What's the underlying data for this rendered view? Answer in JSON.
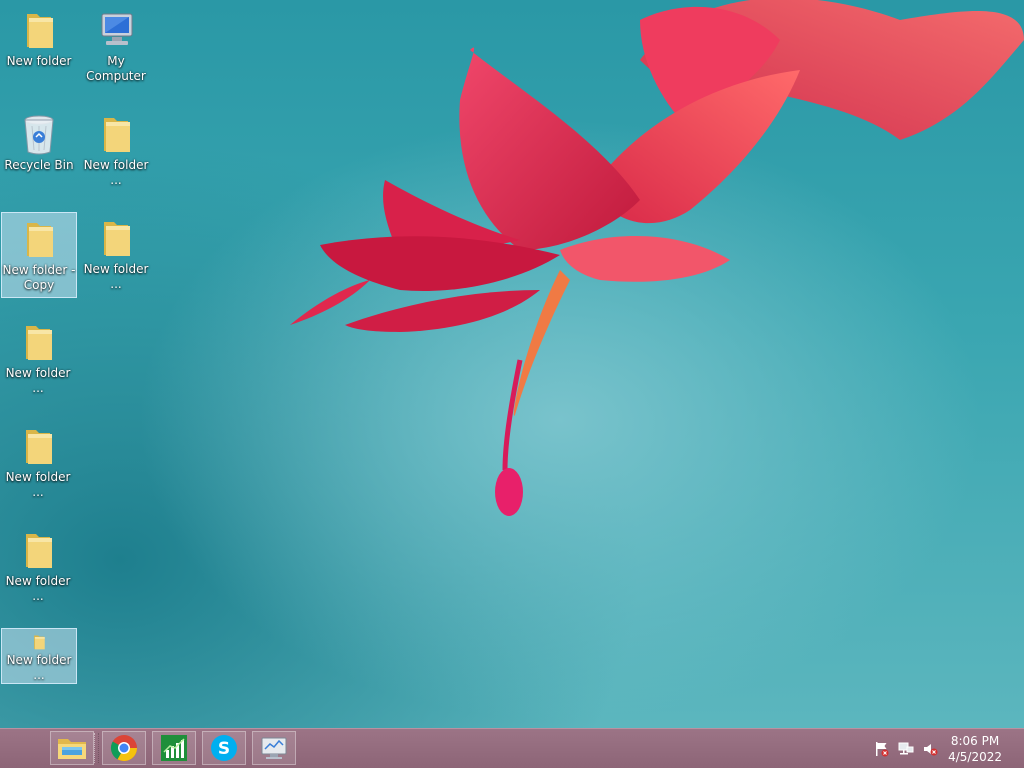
{
  "desktop": {
    "icons": [
      {
        "label": "New folder",
        "icon": "folder-icon",
        "selected": false
      },
      {
        "label": "My Computer",
        "icon": "computer-icon",
        "selected": false
      },
      {
        "label": "Recycle Bin",
        "icon": "recycle-bin-icon",
        "selected": false
      },
      {
        "label": "New folder ...",
        "icon": "folder-icon",
        "selected": false
      },
      {
        "label": "New folder - Copy",
        "icon": "folder-icon",
        "selected": true
      },
      {
        "label": "New folder ...",
        "icon": "folder-icon",
        "selected": false
      },
      {
        "label": "New folder ...",
        "icon": "folder-icon",
        "selected": false
      },
      {
        "label": "New folder ...",
        "icon": "folder-icon",
        "selected": false
      },
      {
        "label": "New folder ...",
        "icon": "folder-icon",
        "selected": false
      },
      {
        "label": "New folder ...",
        "icon": "folder-icon",
        "selected": true
      }
    ]
  },
  "taskbar": {
    "pinned": [
      {
        "name": "file-explorer-icon"
      },
      {
        "name": "chrome-icon"
      },
      {
        "name": "task-manager-icon"
      },
      {
        "name": "skype-icon"
      },
      {
        "name": "system-monitor-icon"
      }
    ],
    "tray": [
      {
        "name": "action-center-flag-icon"
      },
      {
        "name": "network-icon"
      },
      {
        "name": "volume-muted-icon"
      }
    ],
    "clock": {
      "time": "8:06 PM",
      "date": "4/5/2022"
    }
  },
  "colors": {
    "wallpaper": "#3aa6b1",
    "flower": "#e0284e",
    "taskbar": "#9c7486"
  }
}
